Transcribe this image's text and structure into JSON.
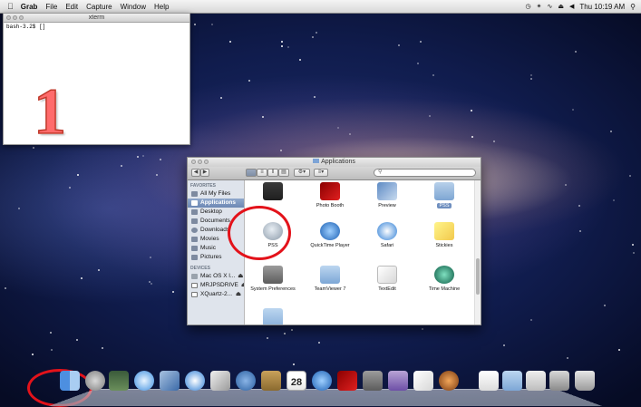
{
  "menubar": {
    "apple": "",
    "app_name": "Grab",
    "items": [
      "File",
      "Edit",
      "Capture",
      "Window",
      "Help"
    ],
    "clock": "Thu 10:19 AM"
  },
  "xterm": {
    "title": "xterm",
    "prompt": "bash-3.2$ []"
  },
  "annotation": {
    "number": "1"
  },
  "finder": {
    "title": "Applications",
    "sidebar": {
      "favorites_heading": "FAVORITES",
      "favorites": [
        "All My Files",
        "Applications",
        "Desktop",
        "Documents",
        "Downloads",
        "Movies",
        "Music",
        "Pictures"
      ],
      "devices_heading": "DEVICES",
      "devices": [
        "Mac OS X l...",
        "MRJPSDRIVE",
        "XQuartz-2..."
      ]
    },
    "apps": [
      {
        "label": "",
        "icon": "preview-app-icon"
      },
      {
        "label": "Photo Booth",
        "icon": "photo-booth-icon"
      },
      {
        "label": "Preview",
        "icon": "preview-icon"
      },
      {
        "label": "PSS",
        "icon": "pss-folder-icon"
      },
      {
        "label": "PSS",
        "icon": "pss-app-icon"
      },
      {
        "label": "QuickTime Player",
        "icon": "quicktime-icon"
      },
      {
        "label": "Safari",
        "icon": "safari-icon"
      },
      {
        "label": "Stickies",
        "icon": "stickies-icon"
      },
      {
        "label": "System Preferences",
        "icon": "system-preferences-icon"
      },
      {
        "label": "TeamViewer 7",
        "icon": "folder-icon"
      },
      {
        "label": "TextEdit",
        "icon": "textedit-icon"
      },
      {
        "label": "Time Machine",
        "icon": "time-machine-icon"
      },
      {
        "label": "",
        "icon": "utilities-folder-icon"
      }
    ]
  },
  "colors": {
    "annotation_red": "#e3121a",
    "selection_blue": "#6d88b4"
  }
}
